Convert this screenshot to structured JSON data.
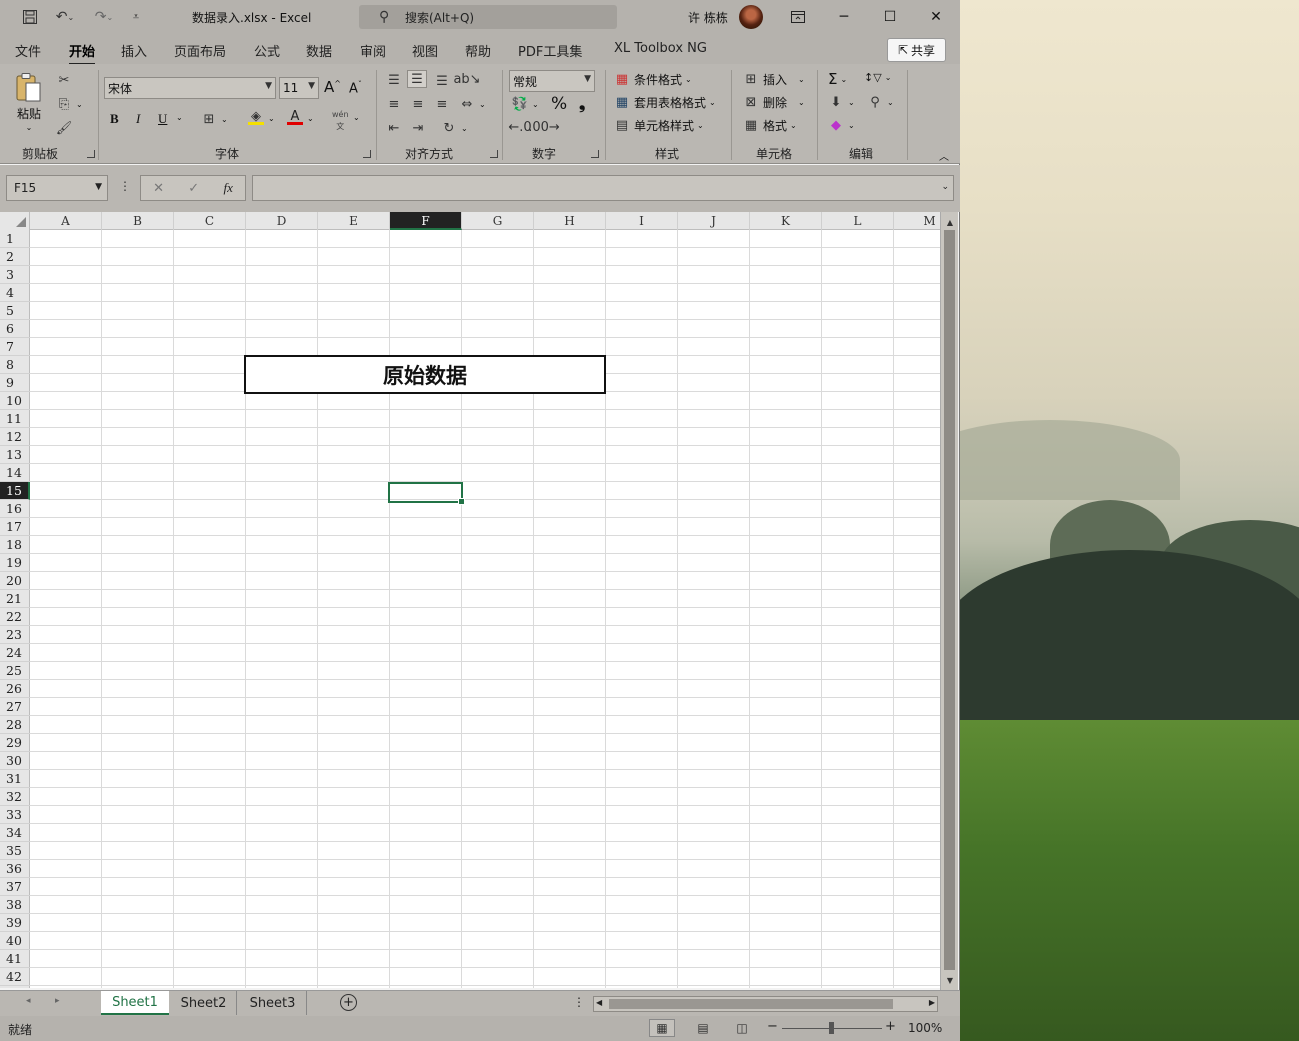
{
  "app": {
    "document_title": "数据录入.xlsx  -  Excel",
    "search_placeholder": "搜索(Alt+Q)",
    "user_name": "许 栋栋"
  },
  "ribbon_tabs": [
    "文件",
    "开始",
    "插入",
    "页面布局",
    "公式",
    "数据",
    "审阅",
    "视图",
    "帮助",
    "PDF工具集",
    "XL Toolbox NG"
  ],
  "active_tab": "开始",
  "share_label": "共享",
  "ribbon": {
    "clipboard": {
      "label": "剪贴板",
      "paste_label": "粘贴"
    },
    "font": {
      "label": "字体",
      "font_name": "宋体",
      "font_size": "11",
      "bold": "B",
      "italic": "I",
      "underline": "U",
      "pinyin": "wén"
    },
    "alignment": {
      "label": "对齐方式"
    },
    "number": {
      "label": "数字",
      "format": "常规"
    },
    "styles": {
      "label": "样式",
      "conditional": "条件格式",
      "table_format": "套用表格格式",
      "cell_styles": "单元格样式"
    },
    "cells": {
      "label": "单元格",
      "insert": "插入",
      "delete": "删除",
      "format": "格式"
    },
    "editing": {
      "label": "编辑"
    }
  },
  "formula_bar": {
    "name_box": "F15",
    "formula": ""
  },
  "grid": {
    "columns": [
      "A",
      "B",
      "C",
      "D",
      "E",
      "F",
      "G",
      "H",
      "I",
      "J",
      "K",
      "L",
      "M"
    ],
    "rows": [
      "1",
      "2",
      "3",
      "4",
      "5",
      "6",
      "7",
      "8",
      "9",
      "10",
      "11",
      "12",
      "13",
      "14",
      "15",
      "16",
      "17",
      "18",
      "19",
      "20",
      "21",
      "22",
      "23",
      "24",
      "25",
      "26",
      "27",
      "28",
      "29",
      "30",
      "31",
      "32",
      "33",
      "34",
      "35",
      "36",
      "37",
      "38",
      "39",
      "40",
      "41",
      "42"
    ],
    "selected_column": "F",
    "selected_row": "15",
    "merged_title": "原始数据"
  },
  "sheets": [
    "Sheet1",
    "Sheet2",
    "Sheet3"
  ],
  "active_sheet": "Sheet1",
  "status": {
    "text": "就绪",
    "zoom": "100%"
  },
  "colors": {
    "accent": "#217346",
    "ribbon_bg": "#bab7b2",
    "titlebar_bg": "#b5b2ad"
  }
}
